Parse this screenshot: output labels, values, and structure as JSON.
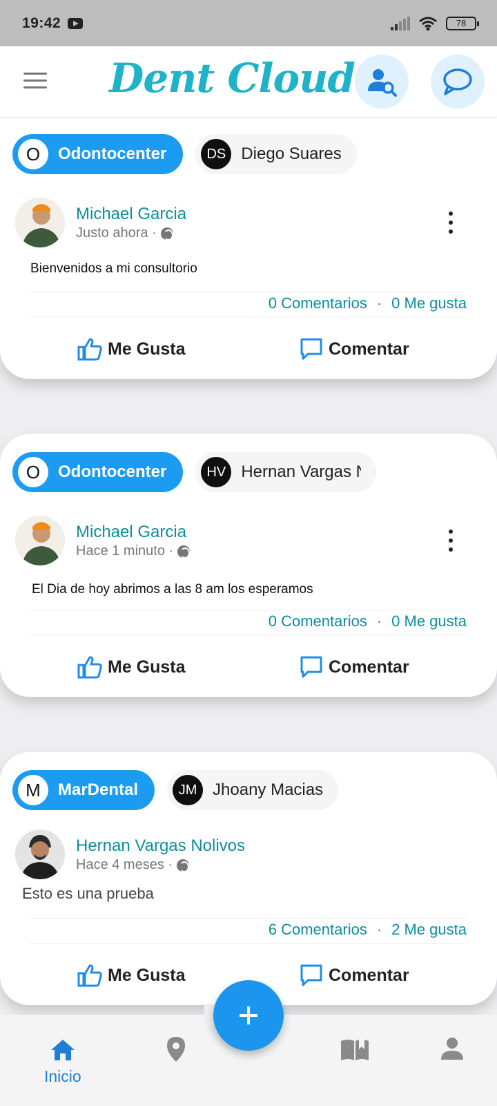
{
  "status_bar": {
    "time": "19:42",
    "battery": "78"
  },
  "header": {
    "logo": "Dent Cloud"
  },
  "posts": [
    {
      "clinic_initial": "O",
      "clinic_name": "Odontocenter",
      "doctor_initials": "DS",
      "doctor_name": "Diego Suares",
      "author": "Michael Garcia",
      "time": "Justo ahora ·",
      "text": "Bienvenidos a mi consultorio",
      "comments": "0 Comentarios",
      "likes": "0 Me gusta",
      "like_label": "Me Gusta",
      "comment_label": "Comentar"
    },
    {
      "clinic_initial": "O",
      "clinic_name": "Odontocenter",
      "doctor_initials": "HV",
      "doctor_name": "Hernan Vargas N",
      "author": "Michael Garcia",
      "time": "Hace 1 minuto ·",
      "text": "El Dia de hoy abrimos a las  8 am los esperamos",
      "comments": "0 Comentarios",
      "likes": "0 Me gusta",
      "like_label": "Me Gusta",
      "comment_label": "Comentar"
    },
    {
      "clinic_initial": "M",
      "clinic_name": "MarDental",
      "doctor_initials": "JM",
      "doctor_name": "Jhoany Macias",
      "author": "Hernan Vargas Nolivos",
      "time": "Hace 4 meses ·",
      "text": "Esto es una prueba",
      "comments": "6 Comentarios",
      "likes": "2 Me gusta",
      "like_label": "Me Gusta",
      "comment_label": "Comentar"
    }
  ],
  "stats_separator": "·",
  "bottom_nav": {
    "home_label": "Inicio"
  },
  "colors": {
    "accent": "#1c9cf0",
    "teal": "#0c8e9c",
    "logo": "#1fb3c9"
  },
  "icons": [
    "menu-icon",
    "user-search-icon",
    "chat-icon",
    "globe-icon",
    "more-vert-icon",
    "thumb-up-icon",
    "comment-icon",
    "plus-icon",
    "home-icon",
    "location-icon",
    "book-icon",
    "person-icon"
  ]
}
